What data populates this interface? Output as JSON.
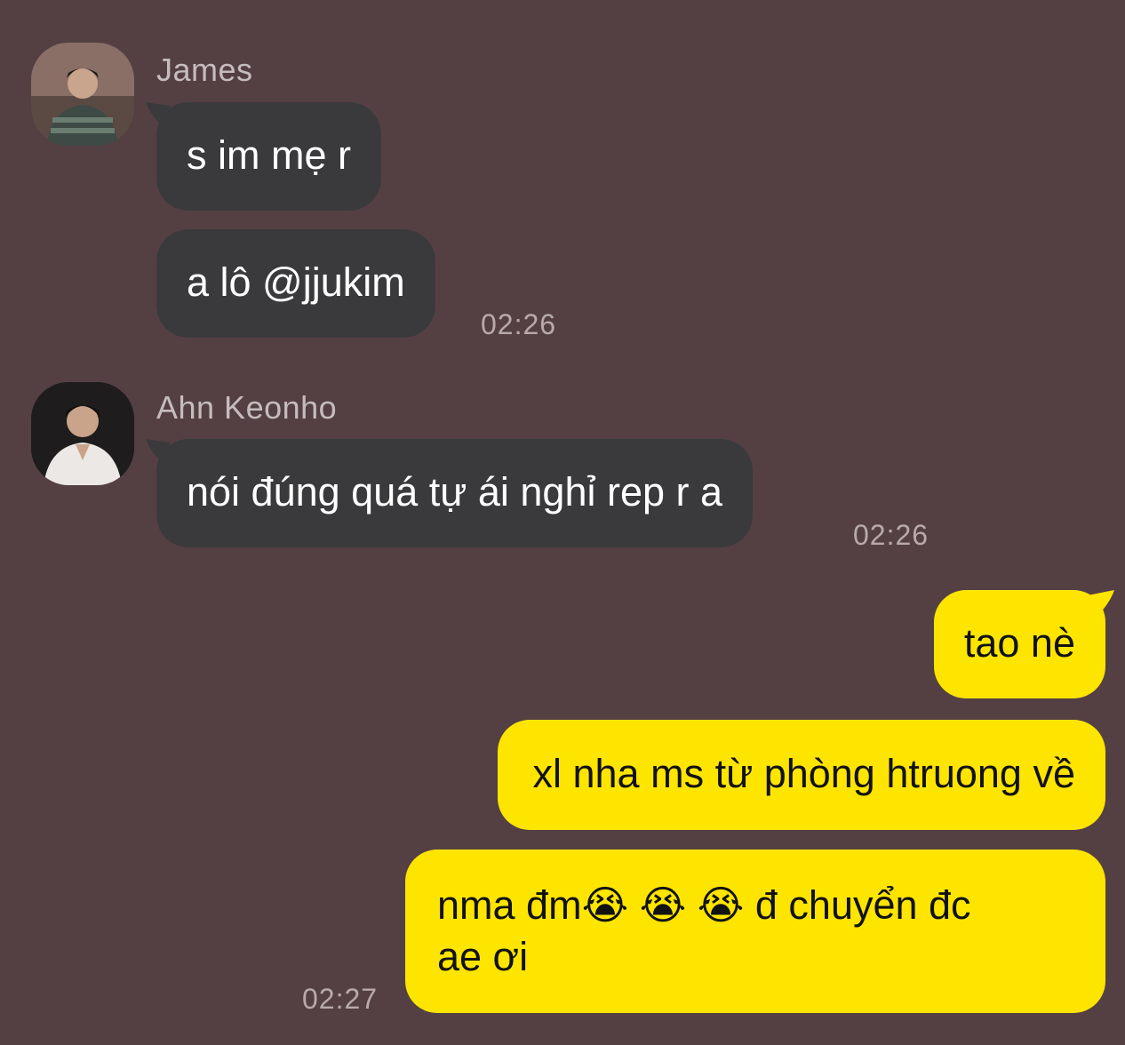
{
  "colors": {
    "background": "#544043",
    "incoming_bubble": "#3a3a3c",
    "outgoing_bubble": "#fee500",
    "sender_name": "#c7bcbd",
    "timestamp": "#b8aaab"
  },
  "messages": {
    "james": {
      "sender": "James",
      "avatar_icon": "person-avatar",
      "bubbles": [
        "s im mẹ r",
        "a lô @jjukim"
      ],
      "time": "02:26"
    },
    "keonho": {
      "sender": "Ahn Keonho",
      "avatar_icon": "person-avatar",
      "bubbles": [
        "nói đúng quá tự ái nghỉ rep r a"
      ],
      "time": "02:26"
    },
    "me": {
      "bubbles": [
        "tao nè",
        "xl nha ms từ phòng htruong về"
      ],
      "last_bubble": {
        "line1_prefix": "nma đm",
        "emoji": [
          "😭",
          "😭",
          "😭"
        ],
        "line1_suffix": "đ chuyển đc",
        "line2": "ae ơi"
      },
      "time": "02:27"
    }
  }
}
